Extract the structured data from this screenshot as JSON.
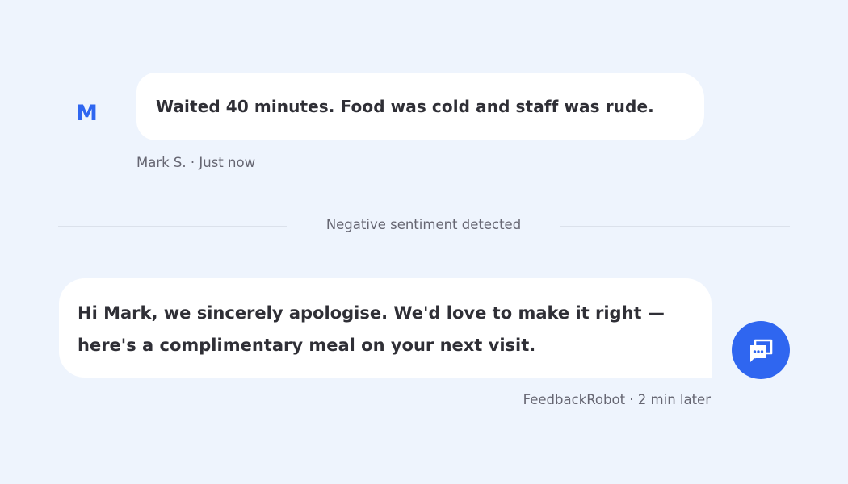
{
  "user_message": {
    "avatar_initial": "M",
    "text": "Waited 40 minutes. Food was cold and staff was rude.",
    "meta": "Mark S. · Just now"
  },
  "sentiment_divider": {
    "label": "Negative sentiment detected"
  },
  "bot_message": {
    "line1": "Hi Mark, we sincerely apologise. We'd love to make it right —",
    "line2": "here's a complimentary meal on your next visit.",
    "meta": "FeedbackRobot · 2 min later",
    "avatar_icon": "chat-bubble-icon"
  },
  "colors": {
    "background": "#eef4fd",
    "accent": "#2f66f0",
    "bubble": "#ffffff",
    "text": "#2f2f36",
    "muted_text": "#666672"
  }
}
